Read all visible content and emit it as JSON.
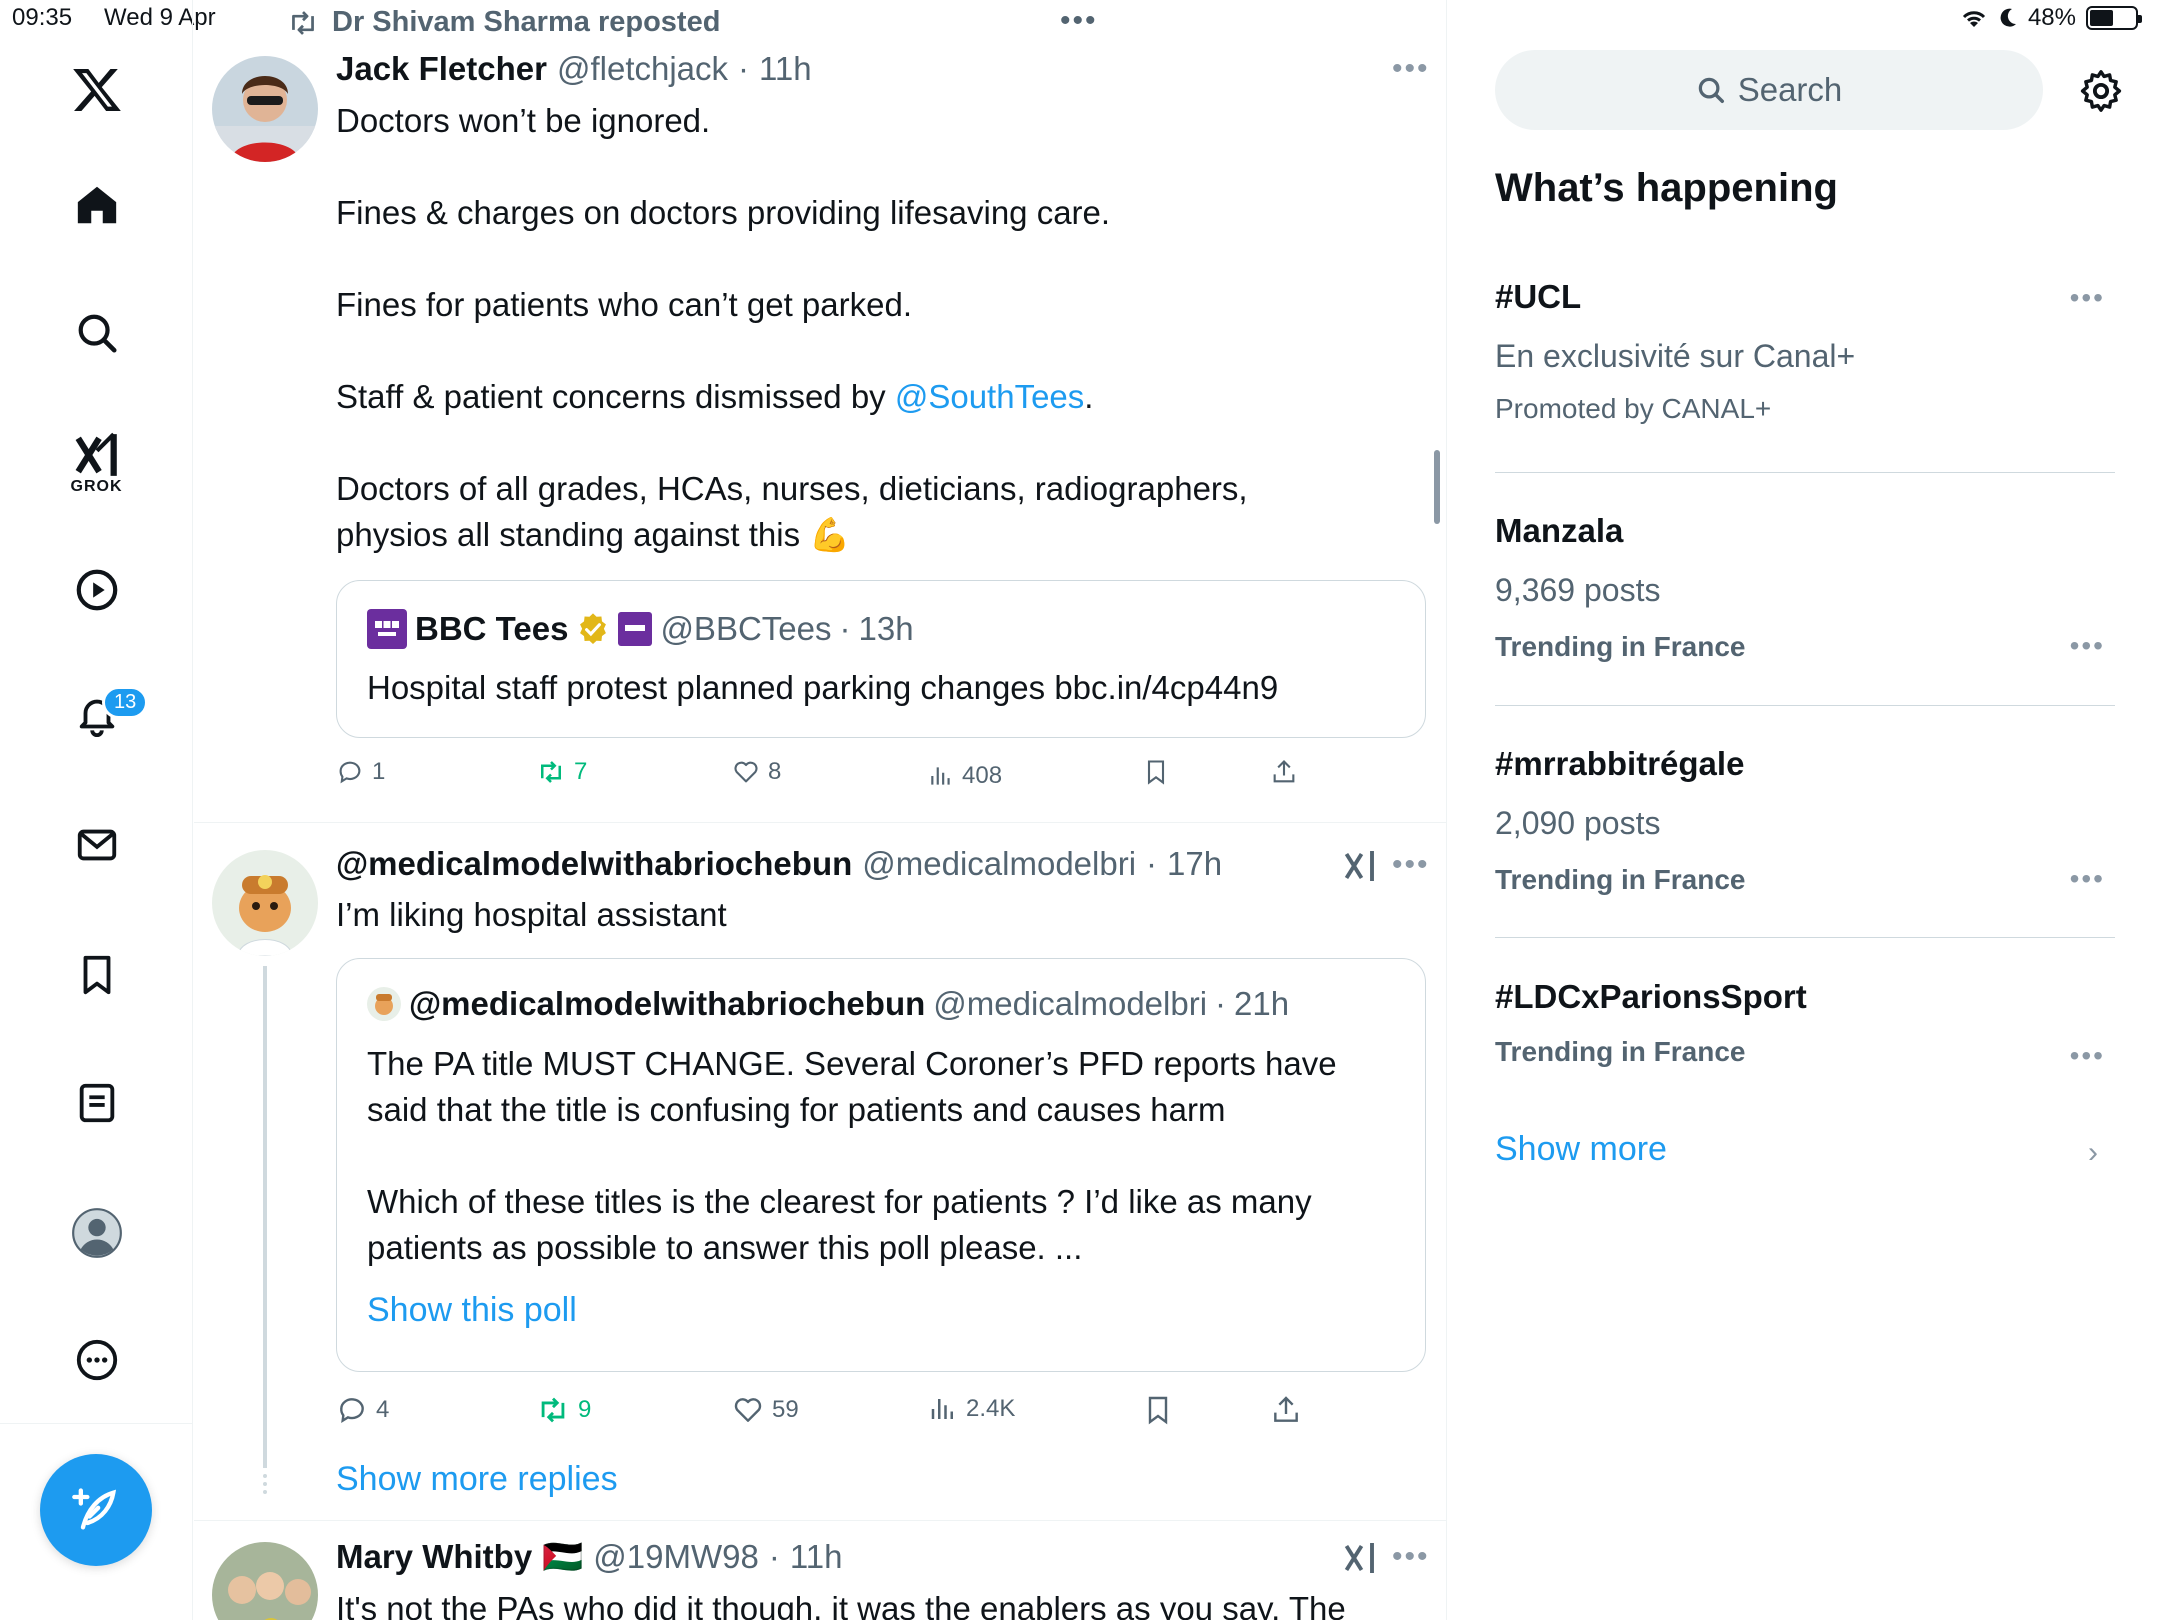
{
  "status_bar": {
    "time": "09:35",
    "date": "Wed 9 Apr",
    "battery": "48%",
    "battery_level": 0.48
  },
  "nav": {
    "grok_label": "GROK",
    "notifications_count": "13"
  },
  "feed": {
    "repost_label": "Dr Shivam Sharma reposted",
    "tweet1": {
      "name": "Jack Fletcher",
      "handle": "@fletchjack",
      "time": "11h",
      "p1": "Doctors won’t be ignored.",
      "p2": "Fines & charges on doctors providing lifesaving care.",
      "p3": "Fines for patients who can’t get parked.",
      "p4_before": "Staff & patient concerns dismissed by ",
      "p4_link": "@SouthTees",
      "p4_after": ".",
      "p5": "Doctors of all grades, HCAs, nurses, dieticians, radiographers, physios all standing against this",
      "p5_emoji": "💪",
      "quote": {
        "name": "BBC Tees",
        "handle": "@BBCTees",
        "time": "13h",
        "text": "Hospital staff protest planned parking changes bbc.in/4cp44n9"
      },
      "replies": "1",
      "reposts": "7",
      "likes": "8",
      "views": "408"
    },
    "tweet2": {
      "name": "@medicalmodelwithabriochebun",
      "handle": "@medicalmodelbri",
      "time": "17h",
      "text": "I’m liking hospital assistant",
      "quote": {
        "name": "@medicalmodelwithabriochebun",
        "handle": "@medicalmodelbri",
        "time": "21h",
        "p1": "The PA title MUST CHANGE. Several Coroner’s PFD reports have said that the title is confusing for patients and causes harm",
        "p2": "Which of these titles is the clearest for patients ? I’d like as many patients as possible to answer this poll please. ...",
        "poll_link": "Show this poll"
      },
      "replies": "4",
      "reposts": "9",
      "likes": "59",
      "views": "2.4K",
      "show_more_replies": "Show more replies"
    },
    "tweet3": {
      "name": "Mary Whitby",
      "flag": "🇵🇸",
      "handle": "@19MW98",
      "time": "11h",
      "text": "It's not the PAs who did it though,  it was the enablers as you say. The"
    }
  },
  "sidebar": {
    "search_placeholder": "Search",
    "heading": "What’s happening",
    "trends": [
      {
        "title": "#UCL",
        "subtitle": "En exclusivité sur Canal+",
        "meta": "Promoted by CANAL+"
      },
      {
        "title": "Manzala",
        "subtitle": "9,369 posts",
        "meta": "Trending in France"
      },
      {
        "title": "#mrrabbitrégale",
        "subtitle": "2,090 posts",
        "meta": "Trending in France"
      },
      {
        "title": "#LDCxParionsSport",
        "meta": "Trending in France"
      }
    ],
    "show_more": "Show more"
  },
  "colors": {
    "accent": "#1d9bf0",
    "repost_green": "#00ba7c",
    "secondary_text": "#536471"
  }
}
